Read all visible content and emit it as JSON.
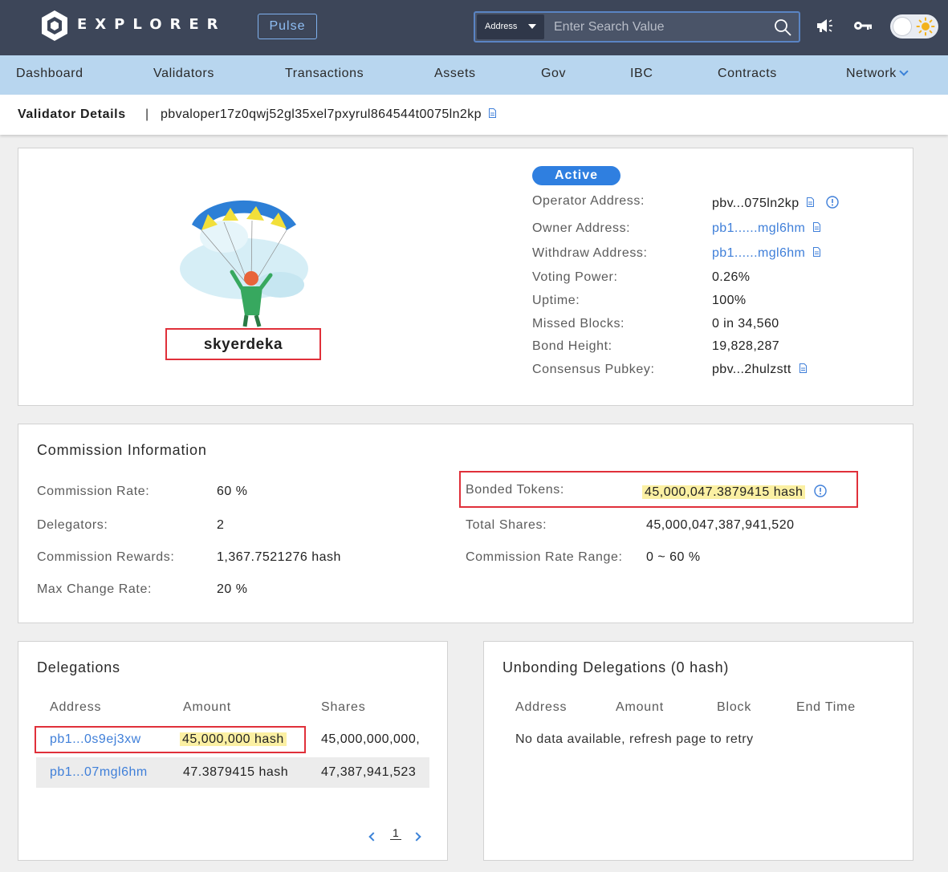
{
  "header": {
    "brand": "EXPLORER",
    "pulse_label": "Pulse",
    "search": {
      "type": "Address",
      "placeholder": "Enter Search Value"
    }
  },
  "nav": {
    "items": [
      "Dashboard",
      "Validators",
      "Transactions",
      "Assets",
      "Gov",
      "IBC",
      "Contracts",
      "Network"
    ]
  },
  "breadcrumb": {
    "title": "Validator Details",
    "separator": "|",
    "address": "pbvaloper17z0qwj52gl35xel7pxyrul864544t0075ln2kp"
  },
  "validator": {
    "name": "skyerdeka",
    "status": "Active",
    "fields": [
      {
        "label": "Operator Address:",
        "value": "pbv...075ln2kp"
      },
      {
        "label": "Owner Address:",
        "value": "pb1......mgl6hm"
      },
      {
        "label": "Withdraw Address:",
        "value": "pb1......mgl6hm"
      },
      {
        "label": "Voting Power:",
        "value": "0.26%"
      },
      {
        "label": "Uptime:",
        "value": "100%"
      },
      {
        "label": "Missed Blocks:",
        "value": "0 in 34,560"
      },
      {
        "label": "Bond Height:",
        "value": "19,828,287"
      },
      {
        "label": "Consensus Pubkey:",
        "value": "pbv...2hulzstt"
      }
    ]
  },
  "commission": {
    "title": "Commission Information",
    "left": [
      {
        "label": "Commission Rate:",
        "value": "60 %"
      },
      {
        "label": "Delegators:",
        "value": "2"
      },
      {
        "label": "Commission Rewards:",
        "value": "1,367.7521276 hash"
      },
      {
        "label": "Max Change Rate:",
        "value": "20 %"
      }
    ],
    "right": [
      {
        "label": "Bonded Tokens:",
        "value": "45,000,047.3879415 hash"
      },
      {
        "label": "Total Shares:",
        "value": "45,000,047,387,941,520"
      },
      {
        "label": "Commission Rate Range:",
        "value": "0 ~ 60 %"
      }
    ]
  },
  "delegations": {
    "title": "Delegations",
    "columns": [
      "Address",
      "Amount",
      "Shares"
    ],
    "rows": [
      {
        "address": "pb1...0s9ej3xw",
        "amount": "45,000,000 hash",
        "shares": "45,000,000,000,"
      },
      {
        "address": "pb1...07mgl6hm",
        "amount": "47.3879415 hash",
        "shares": "47,387,941,523"
      }
    ],
    "page": "1"
  },
  "unbonding": {
    "title": "Unbonding Delegations (0 hash)",
    "columns": [
      "Address",
      "Amount",
      "Block",
      "End Time"
    ],
    "empty_message": "No data available, refresh page to retry"
  },
  "colors": {
    "header_bg": "#3d4659",
    "nav_bg": "#b8d6ef",
    "accent": "#2f7fe0",
    "link": "#3f7fd9",
    "highlight": "#fbf0a3",
    "annotation_red": "#e0303a"
  }
}
